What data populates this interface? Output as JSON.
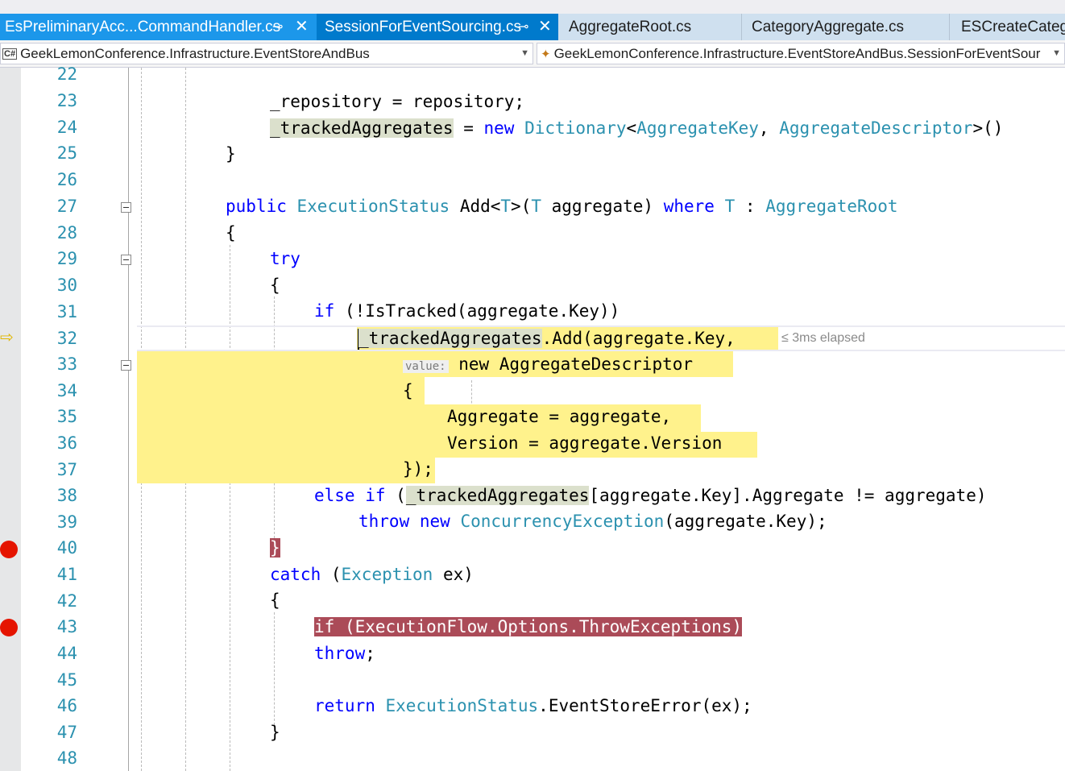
{
  "tabs": [
    {
      "label": "EsPreliminaryAcc...CommandHandler.cs",
      "pin": "⊸",
      "close": "✕",
      "active": false,
      "highlight": true
    },
    {
      "label": "SessionForEventSourcing.cs",
      "pin": "⊸",
      "close": "✕",
      "active": true
    },
    {
      "label": "AggregateRoot.cs",
      "active": false
    },
    {
      "label": "CategoryAggregate.cs",
      "active": false
    },
    {
      "label": "ESCreateCatego",
      "active": false
    }
  ],
  "navbar": {
    "project_icon": "C#",
    "project": "GeekLemonConference.Infrastructure.EventStoreAndBus",
    "member_icon": "class-icon",
    "member": "GeekLemonConference.Infrastructure.EventStoreAndBus.SessionForEventSour"
  },
  "line_numbers": [
    "22",
    "23",
    "24",
    "25",
    "26",
    "27",
    "28",
    "29",
    "30",
    "31",
    "32",
    "33",
    "34",
    "35",
    "36",
    "37",
    "38",
    "39",
    "40",
    "41",
    "42",
    "43",
    "44",
    "45",
    "46",
    "47",
    "48"
  ],
  "breakpoints": [
    "40",
    "43"
  ],
  "current_line": "32",
  "code": {
    "l23_a": "_repository = repository;",
    "l24_ref": "_trackedAggregates",
    "l24_eq": " = ",
    "l24_new": "new",
    "l24_dict": "Dictionary",
    "l24_lt": "<",
    "l24_key": "AggregateKey",
    "l24_comma": ", ",
    "l24_desc": "AggregateDescriptor",
    "l24_end": ">()",
    "l25": "}",
    "l27_public": "public",
    "l27_type": "ExecutionStatus",
    "l27_add": " Add<",
    "l27_T1": "T",
    "l27_paren": ">(",
    "l27_T2": "T",
    "l27_agg": " aggregate) ",
    "l27_where": "where",
    "l27_T3": "T",
    "l27_colon": " : ",
    "l27_root": "AggregateRoot",
    "l28": "{",
    "l29": "try",
    "l30": "{",
    "l31_if": "if",
    "l31_rest": " (!IsTracked(aggregate.Key))",
    "l32_ref": "_trackedAggregates",
    "l32_rest": ".Add(aggregate.Key, ",
    "l32_hint": "≤ 3ms elapsed",
    "l33_param": "value:",
    "l33_rest": " new AggregateDescriptor",
    "l34": "{",
    "l35": "Aggregate = aggregate,",
    "l36": "Version = aggregate.Version",
    "l37": "});",
    "l38_else": "else",
    "l38_if": "if",
    "l38_open": " (",
    "l38_ref": "_trackedAggregates",
    "l38_rest": "[aggregate.Key].Aggregate != aggregate)",
    "l39_throw": "throw",
    "l39_new": "new",
    "l39_type": "ConcurrencyException",
    "l39_rest": "(aggregate.Key);",
    "l40": "}",
    "l41_catch": "catch",
    "l41_open": " (",
    "l41_type": "Exception",
    "l41_rest": " ex)",
    "l42": "{",
    "l43_if": "if",
    "l43_rest": " (ExecutionFlow.Options.ThrowExceptions)",
    "l44_throw": "throw",
    "l44_semi": ";",
    "l46_return": "return",
    "l46_type": "ExecutionStatus",
    "l46_rest": ".EventStoreError(ex);",
    "l47": "}"
  },
  "colors": {
    "keyword": "#0000ff",
    "type": "#2b91af",
    "tab_active": "#007acc",
    "statement_highlight": "#fff28c",
    "breakpoint": "#e51400",
    "breakpoint_text_bg": "#ab4b58"
  }
}
